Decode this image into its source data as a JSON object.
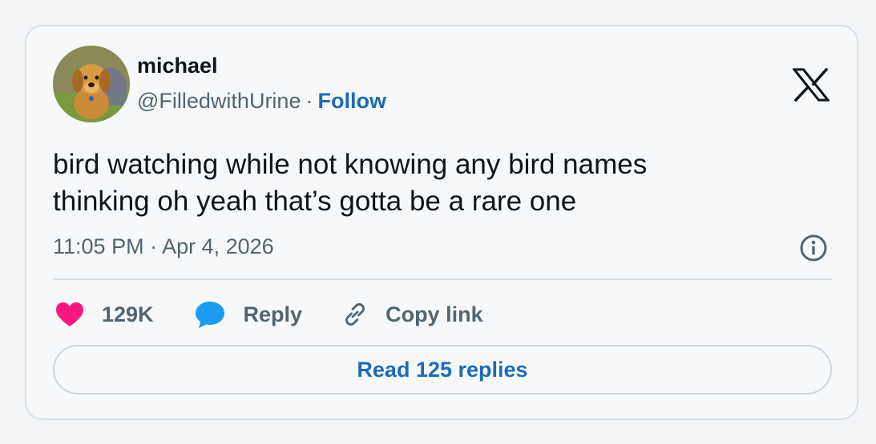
{
  "author": {
    "display_name": "michael",
    "handle": "@FilledwithUrine",
    "separator": "·",
    "follow_label": "Follow"
  },
  "tweet": {
    "text_lines": [
      "bird watching while not knowing any bird names",
      "thinking oh yeah that’s gotta be a rare one"
    ],
    "timestamp": "11:05 PM · Apr 4, 2026"
  },
  "actions": {
    "likes_count": "129K",
    "reply_label": "Reply",
    "copy_link_label": "Copy link"
  },
  "read_replies_label": "Read 125 replies",
  "icons": {
    "brand": "x-logo-icon",
    "info": "info-icon",
    "like": "heart-icon",
    "reply": "speech-bubble-icon",
    "copy": "link-icon"
  },
  "colors": {
    "link": "#1d6bb5",
    "heart": "#f91880",
    "reply_bubble": "#1d9bf0",
    "muted_text": "#536471",
    "primary_text": "#0f1419"
  }
}
